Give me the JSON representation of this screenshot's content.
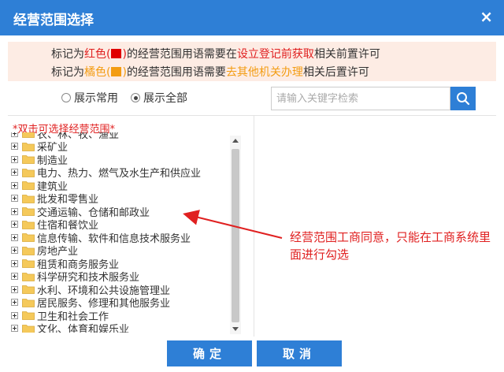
{
  "dialog": {
    "title": "经营范围选择",
    "close_glyph": "×"
  },
  "notice": {
    "line1": {
      "prefix": "标记为",
      "color_word": "红色(",
      "color_end": ")",
      "middle": "的经营范围用语需要在",
      "highlight": "设立登记前获取",
      "suffix": "相关前置许可"
    },
    "line2": {
      "prefix": "标记为",
      "color_word": "橘色(",
      "color_end": ")",
      "middle": "的经营范围用语需要",
      "highlight": "去其他机关办理",
      "suffix": "相关后置许可"
    }
  },
  "view_mode": {
    "options": [
      {
        "label": "展示常用",
        "selected": false
      },
      {
        "label": "展示全部",
        "selected": true
      }
    ]
  },
  "search": {
    "placeholder": "请输入关键字检索",
    "value": ""
  },
  "hint": "*双击可选择经营范围*",
  "tree": {
    "items": [
      "农、林、牧、渔业",
      "采矿业",
      "制造业",
      "电力、热力、燃气及水生产和供应业",
      "建筑业",
      "批发和零售业",
      "交通运输、仓储和邮政业",
      "住宿和餐饮业",
      "信息传输、软件和信息技术服务业",
      "房地产业",
      "租赁和商务服务业",
      "科学研究和技术服务业",
      "水利、环境和公共设施管理业",
      "居民服务、修理和其他服务业",
      "卫生和社会工作",
      "文化、体育和娱乐业"
    ]
  },
  "annotation": "经营范围工商同意，只能在工商系统里面进行勾选",
  "buttons": {
    "ok": "确定",
    "cancel": "取消"
  },
  "colors": {
    "primary": "#2e7fd6",
    "red": "#e02020",
    "orange": "#f39c12",
    "notice_bg": "#fdece4",
    "folder": "#f5c95a"
  },
  "icons": {
    "close": "close-icon",
    "search": "search-icon",
    "folder": "folder-icon",
    "expand": "expand-plus-icon",
    "radio": "radio-icon"
  }
}
